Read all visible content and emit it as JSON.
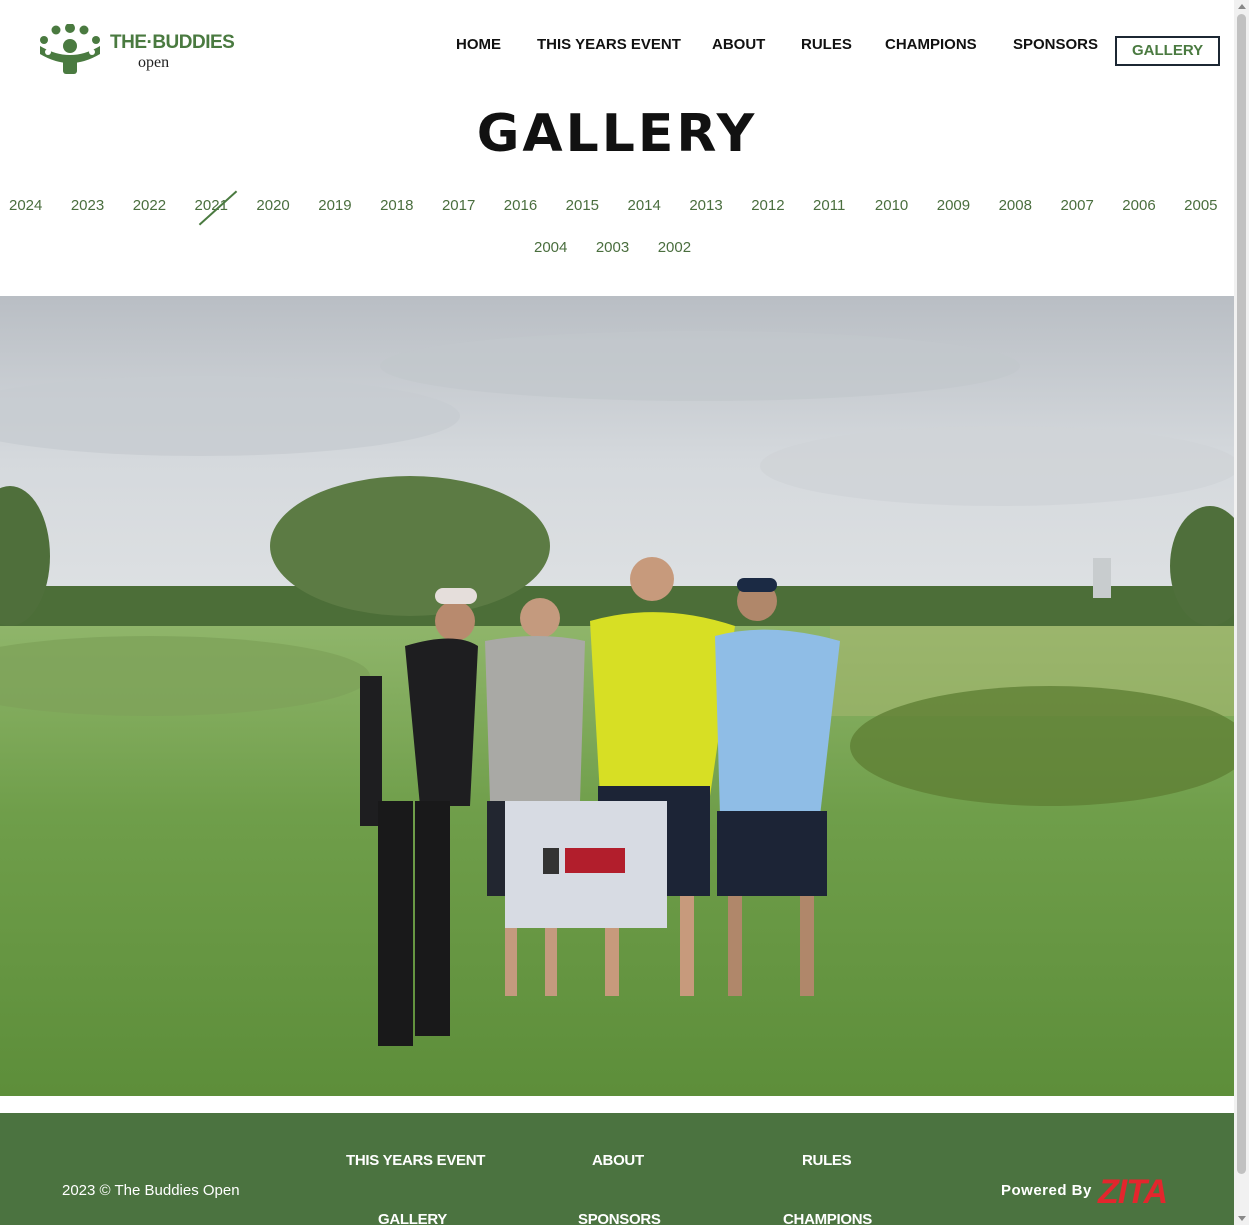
{
  "header": {
    "logo": {
      "line1": "THE·BUDDIES",
      "line2": "open"
    },
    "nav": [
      {
        "label": "HOME"
      },
      {
        "label": "THIS YEARS EVENT"
      },
      {
        "label": "ABOUT"
      },
      {
        "label": "RULES"
      },
      {
        "label": "CHAMPIONS"
      },
      {
        "label": "SPONSORS"
      },
      {
        "label": "GALLERY",
        "active": true
      }
    ]
  },
  "page": {
    "title": "GALLERY"
  },
  "years": {
    "row1": [
      "2024",
      "2023",
      "2022",
      "2021",
      "2020",
      "2019",
      "2018",
      "2017",
      "2016",
      "2015",
      "2014",
      "2013",
      "2012",
      "2011",
      "2010",
      "2009",
      "2008",
      "2007",
      "2006",
      "2005"
    ],
    "row2": [
      "2004",
      "2003",
      "2002"
    ],
    "selected": "2021"
  },
  "photo": {
    "subject": "four golfers posing on a golf course with a sponsor sign"
  },
  "footer": {
    "copyright": "2023 © The Buddies Open",
    "links": {
      "this_years_event": "THIS YEARS EVENT",
      "about": "ABOUT",
      "rules": "RULES",
      "gallery": "GALLERY",
      "sponsors": "SPONSORS",
      "champions": "CHAMPIONS"
    },
    "powered_by": "Powered By",
    "powered_brand": "ZITA"
  },
  "colors": {
    "brand_green": "#4b7340",
    "accent_red": "#e3262d",
    "nav_border": "#1c2733"
  }
}
